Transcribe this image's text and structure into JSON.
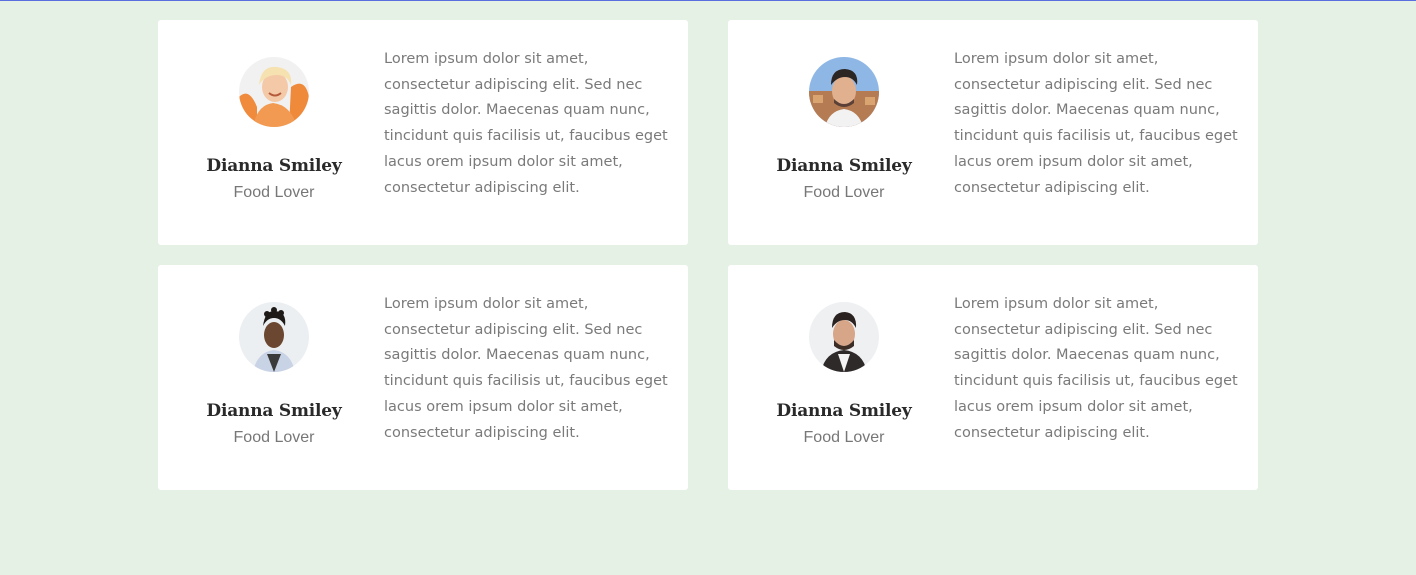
{
  "testimonials": [
    {
      "name": "Dianna Smiley",
      "role": "Food Lover",
      "quote": "Lorem ipsum dolor sit amet, consectetur adipiscing elit. Sed nec sagittis dolor. Maecenas quam nunc, tincidunt quis facilisis ut, faucibus eget lacus orem ipsum dolor sit amet, consectetur adipiscing elit.",
      "avatar": "woman-orange-background-photo"
    },
    {
      "name": "Dianna Smiley",
      "role": "Food Lover",
      "quote": "Lorem ipsum dolor sit amet, consectetur adipiscing elit. Sed nec sagittis dolor. Maecenas quam nunc, tincidunt quis facilisis ut, faucibus eget lacus orem ipsum dolor sit amet, consectetur adipiscing elit.",
      "avatar": "man-blue-sky-photo"
    },
    {
      "name": "Dianna Smiley",
      "role": "Food Lover",
      "quote": "Lorem ipsum dolor sit amet, consectetur adipiscing elit. Sed nec sagittis dolor. Maecenas quam nunc, tincidunt quis facilisis ut, faucibus eget lacus orem ipsum dolor sit amet, consectetur adipiscing elit.",
      "avatar": "man-light-jacket-photo"
    },
    {
      "name": "Dianna Smiley",
      "role": "Food Lover",
      "quote": "Lorem ipsum dolor sit amet, consectetur adipiscing elit. Sed nec sagittis dolor. Maecenas quam nunc, tincidunt quis facilisis ut, faucibus eget lacus orem ipsum dolor sit amet, consectetur adipiscing elit.",
      "avatar": "man-dark-jacket-photo"
    }
  ],
  "colors": {
    "background": "#e6f1e6",
    "card": "#ffffff",
    "name": "#2a2a2a",
    "text": "#7a7a7a",
    "top_rule": "#5b6ee0"
  }
}
